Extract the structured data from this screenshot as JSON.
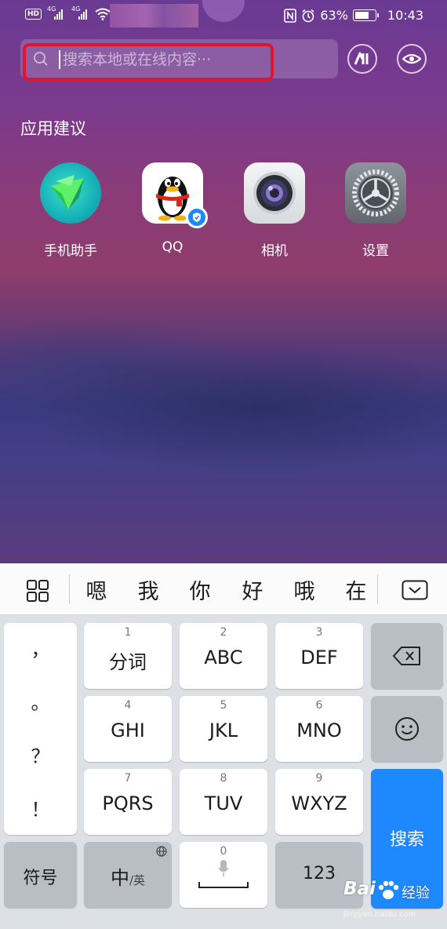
{
  "status_bar": {
    "network_hd": "HD",
    "network_type_1": "4G",
    "network_type_2": "4G",
    "battery": "63%",
    "time": "10:43",
    "icons": [
      "nfc-icon",
      "alarm-icon",
      "battery-icon",
      "wifi-icon",
      "signal-icon"
    ]
  },
  "search": {
    "placeholder": "搜索本地或在线内容···",
    "value": "",
    "highlight_color": "#e0152c"
  },
  "suggestions": {
    "title": "应用建议",
    "apps": [
      {
        "label": "手机助手",
        "icon": "phone-assistant-icon"
      },
      {
        "label": "QQ",
        "icon": "qq-penguin-icon"
      },
      {
        "label": "相机",
        "icon": "camera-icon"
      },
      {
        "label": "设置",
        "icon": "settings-gear-icon"
      }
    ]
  },
  "keyboard": {
    "candidates": [
      "嗯",
      "我",
      "你",
      "好",
      "哦",
      "在"
    ],
    "punctuation": [
      "，",
      "。",
      "？",
      "！"
    ],
    "keys": [
      {
        "num": "1",
        "label": "分词"
      },
      {
        "num": "2",
        "label": "ABC"
      },
      {
        "num": "3",
        "label": "DEF"
      },
      {
        "num": "4",
        "label": "GHI"
      },
      {
        "num": "5",
        "label": "JKL"
      },
      {
        "num": "6",
        "label": "MNO"
      },
      {
        "num": "7",
        "label": "PQRS"
      },
      {
        "num": "8",
        "label": "TUV"
      },
      {
        "num": "9",
        "label": "WXYZ"
      }
    ],
    "symbols_label": "符号",
    "lang_main": "中",
    "lang_sub": "/英",
    "space_num": "0",
    "num_label": "123",
    "search_label": "搜索",
    "accent_color": "#1e88ff"
  },
  "watermark": {
    "brand": "Bai",
    "brand_suffix": "经验",
    "url": "jingyan.baidu.com"
  }
}
